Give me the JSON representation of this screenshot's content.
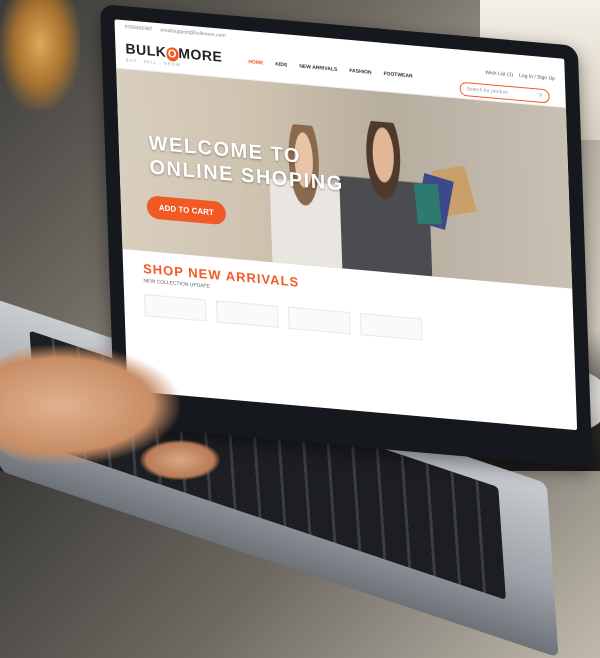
{
  "site": {
    "topbar": {
      "phone": "9789456987",
      "email": "emailsupport@bulkmore.com"
    },
    "logo": {
      "prefix": "BULK",
      "middle": "O",
      "suffix": "MORE",
      "tagline": "BUY · SELL · GROW"
    },
    "nav": [
      "HOME",
      "KIDS",
      "NEW ARRIVALS",
      "FASHION",
      "FOOTWEAR"
    ],
    "account": {
      "wishlist": "Wish List (1)",
      "login": "Log In / Sign Up"
    },
    "search": {
      "placeholder": "Search for product"
    },
    "hero": {
      "line1": "WELCOME TO",
      "line2": "ONLINE SHOPING",
      "cta": "ADD TO CART"
    },
    "arrivals": {
      "title": "SHOP NEW ARRIVALS",
      "subtitle": "NEW COLLECTION UPDATE"
    }
  },
  "colors": {
    "accent": "#f15a24"
  }
}
